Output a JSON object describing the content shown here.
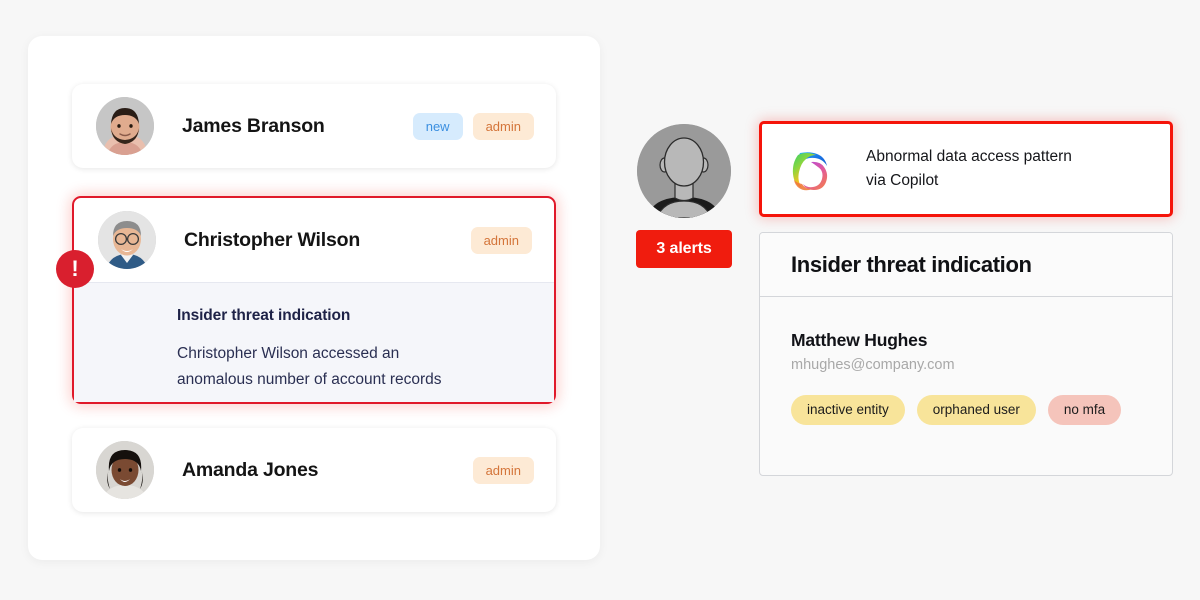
{
  "left_panel": {
    "users": [
      {
        "name": "James Branson",
        "avatar_icon": "avatar-photo-bearded-man",
        "badges": [
          {
            "label": "new",
            "kind": "new"
          },
          {
            "label": "admin",
            "kind": "admin"
          }
        ]
      },
      {
        "name": "Christopher Wilson",
        "avatar_icon": "avatar-photo-glasses-man",
        "badges": [
          {
            "label": "admin",
            "kind": "admin"
          }
        ],
        "alert_icon": "exclamation-icon",
        "alert": {
          "title": "Insider threat indication",
          "body_line1": "Christopher Wilson accessed an",
          "body_line2": "anomalous number of account records"
        }
      },
      {
        "name": "Amanda Jones",
        "avatar_icon": "avatar-photo-woman",
        "badges": [
          {
            "label": "admin",
            "kind": "admin"
          }
        ]
      }
    ]
  },
  "middle": {
    "avatar_icon": "avatar-placeholder-silhouette",
    "alerts_badge": "3 alerts"
  },
  "copilot_alert": {
    "icon": "microsoft-copilot-icon",
    "line1": "Abnormal data access pattern",
    "line2": "via Copilot"
  },
  "threat_card": {
    "title": "Insider threat indication",
    "entity_name": "Matthew Hughes",
    "entity_email": "mhughes@company.com",
    "tags": [
      {
        "label": "inactive entity",
        "kind": "yellow"
      },
      {
        "label": "orphaned user",
        "kind": "yellow"
      },
      {
        "label": "no mfa",
        "kind": "pink"
      }
    ]
  },
  "colors": {
    "page_background": "#f7f7f7",
    "alert_red": "#f01c0e",
    "alert_border_red": "#e0192a",
    "badge_new_bg": "#d6ebfd",
    "badge_new_text": "#3b8fe0",
    "badge_admin_bg": "#fdead5",
    "badge_admin_text": "#d4753a",
    "pill_yellow": "#f8e49a",
    "pill_pink": "#f5c4bb",
    "detail_panel_bg": "#f5f6fa",
    "detail_text": "#1e2247",
    "email_text": "#a8a8a8"
  }
}
